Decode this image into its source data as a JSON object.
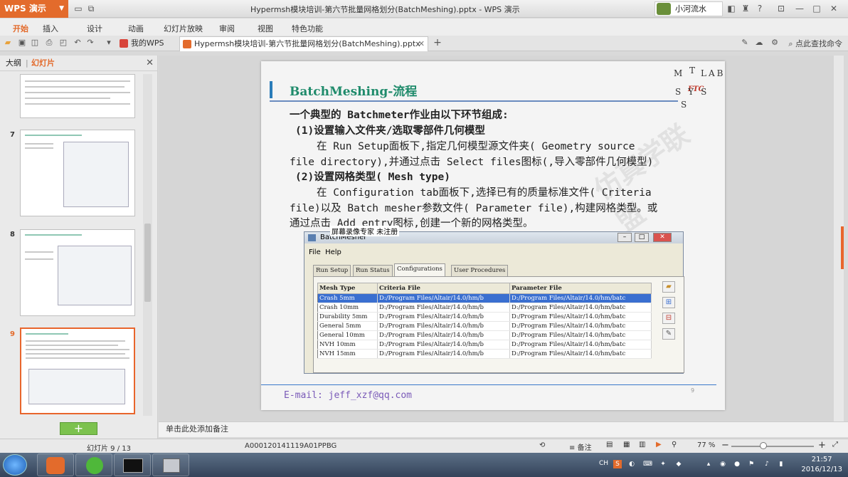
{
  "app": {
    "name": "WPS 演示",
    "window_title": "Hypermsh模块培训-第六节批量网格划分(BatchMeshing).pptx - WPS 演示",
    "user": "小河流水"
  },
  "menu": [
    "开始",
    "插入",
    "设计",
    "动画",
    "幻灯片放映",
    "审阅",
    "视图",
    "特色功能"
  ],
  "tabs": [
    {
      "label": "我的WPS"
    },
    {
      "label": "Hypermsh模块培训-第六节批量网格划分(BatchMeshing).pptx"
    }
  ],
  "search_placeholder": "点此查找命令",
  "left_pane": {
    "tab_outline": "大纲",
    "tab_slides": "幻灯片",
    "numbers": [
      "7",
      "8",
      "9"
    ]
  },
  "slide": {
    "title": "BatchMeshing-流程",
    "lines": [
      "一个典型的 Batchmeter作业由以下环节组成:",
      "(1)设置输入文件夹/选取零部件几何模型",
      "在 Run Setup面板下,指定几何模型源文件夹( Geometry source",
      "file directory),并通过点击 Select files图标(,导入零部件几何模型)",
      "(2)设置网格类型( Mesh type)",
      "在 Configuration tab面板下,选择已有的质量标准文件( Criteria",
      "file)以及 Batch mesher参数文件( Parameter file),构建网格类型。或",
      "通过点击 Add entry图标,创建一个新的网格类型。"
    ],
    "logo": {
      "l1": "M",
      "l2": "T",
      "l3": "LAB",
      "l4": "FTC",
      "l5": "SYS",
      "l6": "S"
    },
    "email": "E-mail: jeff_xzf@qq.com",
    "number": "9",
    "recorder_label": "屏幕录像专家 未注册"
  },
  "batchmesher": {
    "title": "BatchMesher",
    "menu": [
      "File",
      "Help"
    ],
    "tabs": [
      "Run Setup",
      "Run Status",
      "Configurations",
      "User Procedures"
    ],
    "columns": [
      "Mesh Type",
      "Criteria File",
      "Parameter File"
    ],
    "rows": [
      [
        "Crash 5mm",
        "D:/Program Files/Altair/14.0/hm/b",
        "D:/Program Files/Altair/14.0/hm/batc"
      ],
      [
        "Crash 10mm",
        "D:/Program Files/Altair/14.0/hm/b",
        "D:/Program Files/Altair/14.0/hm/batc"
      ],
      [
        "Durability 5mm",
        "D:/Program Files/Altair/14.0/hm/b",
        "D:/Program Files/Altair/14.0/hm/batc"
      ],
      [
        "General 5mm",
        "D:/Program Files/Altair/14.0/hm/b",
        "D:/Program Files/Altair/14.0/hm/batc"
      ],
      [
        "General 10mm",
        "D:/Program Files/Altair/14.0/hm/b",
        "D:/Program Files/Altair/14.0/hm/batc"
      ],
      [
        "NVH 10mm",
        "D:/Program Files/Altair/14.0/hm/b",
        "D:/Program Files/Altair/14.0/hm/batc"
      ],
      [
        "NVH 15mm",
        "D:/Program Files/Altair/14.0/hm/b",
        "D:/Program Files/Altair/14.0/hm/batc"
      ]
    ]
  },
  "notes_placeholder": "单击此处添加备注",
  "status": {
    "slide": "幻灯片 9 / 13",
    "code": "A000120141119A01PPBG",
    "notes": "备注",
    "zoom": "77 %"
  },
  "taskbar": {
    "lang": "CH",
    "time": "21:57",
    "date": "2016/12/13"
  }
}
